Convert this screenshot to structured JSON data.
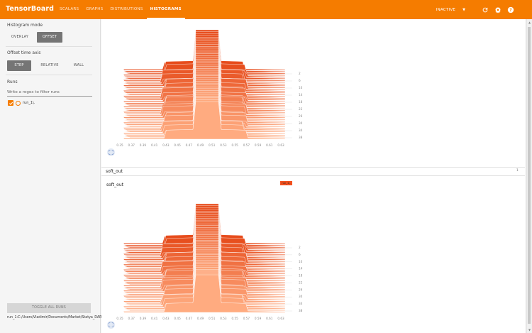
{
  "app": {
    "brand": "TensorBoard",
    "tabs": [
      {
        "label": "SCALARS",
        "active": false
      },
      {
        "label": "GRAPHS",
        "active": false
      },
      {
        "label": "DISTRIBUTIONS",
        "active": false
      },
      {
        "label": "HISTOGRAMS",
        "active": true
      }
    ],
    "status": "INACTIVE",
    "accent": "#f57c00"
  },
  "sidebar": {
    "histogram_mode": {
      "title": "Histogram mode",
      "options": [
        "OVERLAY",
        "OFFSET"
      ],
      "selected": "OFFSET"
    },
    "time_axis": {
      "title": "Offset time axis",
      "options": [
        "STEP",
        "RELATIVE",
        "WALL"
      ],
      "selected": "STEP"
    },
    "runs": {
      "title": "Runs",
      "filter_placeholder": "Write a regex to filter runs",
      "items": [
        {
          "label": "run_1\\.",
          "checked": true
        }
      ]
    },
    "toggle_label": "TOGGLE ALL RUNS",
    "path": "run_1:C:/Users/Vladimir/Documents/Market/Statya_DARCH2/PartVII/run_1"
  },
  "main": {
    "section": {
      "title": "soft_out",
      "count": "1"
    },
    "card_title": "soft_out",
    "run_tag": "run_1\\."
  },
  "chart_data": [
    {
      "type": "histogram",
      "mode": "offset",
      "x_ticks": [
        "0.35",
        "0.37",
        "0.39",
        "0.41",
        "0.43",
        "0.45",
        "0.47",
        "0.49",
        "0.51",
        "0.53",
        "0.55",
        "0.57",
        "0.59",
        "0.61",
        "0.63"
      ],
      "step_ticks": [
        "2",
        "6",
        "10",
        "14",
        "18",
        "22",
        "26",
        "30",
        "34",
        "38"
      ],
      "color_old": "#e64a19",
      "color_new": "#ffab80"
    },
    {
      "type": "histogram",
      "mode": "offset",
      "x_ticks": [
        "0.35",
        "0.37",
        "0.39",
        "0.41",
        "0.43",
        "0.45",
        "0.47",
        "0.49",
        "0.51",
        "0.53",
        "0.55",
        "0.57",
        "0.59",
        "0.61",
        "0.63"
      ],
      "step_ticks": [
        "2",
        "6",
        "10",
        "14",
        "18",
        "22",
        "26",
        "30",
        "34",
        "38"
      ],
      "color_old": "#e64a19",
      "color_new": "#ffab80"
    }
  ]
}
